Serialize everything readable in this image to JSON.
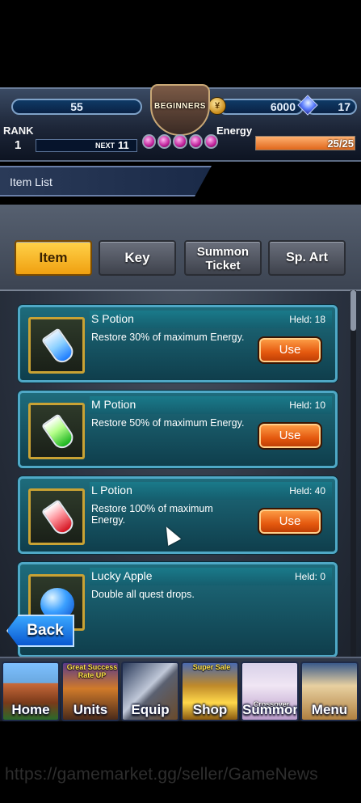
{
  "status": {
    "stamina": "55",
    "gold": "6000",
    "gems": "17",
    "emblem_text": "BEGINNERS",
    "rank_label": "RANK",
    "rank_value": "1",
    "next_label": "NEXT",
    "next_value": "11",
    "energy_label": "Energy",
    "energy_value": "25/25",
    "energy_fraction": 1.0
  },
  "title": "Item List",
  "tabs": [
    {
      "label": "Item",
      "active": true
    },
    {
      "label": "Key",
      "active": false
    },
    {
      "label_line1": "Summon",
      "label_line2": "Ticket",
      "active": false
    },
    {
      "label": "Sp. Art",
      "active": false
    }
  ],
  "items": [
    {
      "name": "S Potion",
      "held": "Held: 18",
      "desc": "Restore 30% of maximum Energy.",
      "button": "Use",
      "icon": "blue-potion-icon"
    },
    {
      "name": "M Potion",
      "held": "Held: 10",
      "desc": "Restore 50% of maximum Energy.",
      "button": "Use",
      "icon": "green-potion-icon"
    },
    {
      "name": "L Potion",
      "held": "Held: 40",
      "desc": "Restore 100% of maximum Energy.",
      "button": "Use",
      "icon": "red-potion-icon"
    },
    {
      "name": "Lucky Apple",
      "held": "Held: 0",
      "desc": "Double all quest drops.",
      "icon": "blue-apple-icon"
    }
  ],
  "back_label": "Back",
  "nav": {
    "home": "Home",
    "units": "Units",
    "units_badge": "Great Success Rate UP",
    "equip": "Equip",
    "shop": "Shop",
    "shop_badge": "Super Sale",
    "summon": "Summon",
    "summon_badge": "Crossover",
    "menu": "Menu"
  },
  "watermark": "https://gamemarket.gg/seller/GameNews"
}
